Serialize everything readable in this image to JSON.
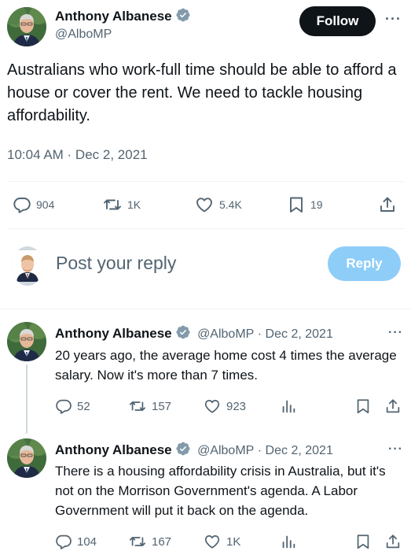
{
  "main_tweet": {
    "author_name": "Anthony Albanese",
    "author_handle": "@AlboMP",
    "follow_label": "Follow",
    "more_label": "···",
    "text": "Australians who work-full time should be able to afford a house or cover the rent. We need to tackle housing affordability.",
    "timestamp": "10:04 AM · Dec 2, 2021",
    "stats": {
      "replies": "904",
      "reposts": "1K",
      "likes": "5.4K",
      "bookmarks": "19"
    }
  },
  "reply_composer": {
    "placeholder": "Post your reply",
    "button_label": "Reply"
  },
  "replies": [
    {
      "author_name": "Anthony Albanese",
      "author_handle": "@AlboMP",
      "date": "· Dec 2, 2021",
      "more_label": "···",
      "text": "20 years ago, the average home cost 4 times the average salary. Now it's more than 7 times.",
      "stats": {
        "replies": "52",
        "reposts": "157",
        "likes": "923"
      }
    },
    {
      "author_name": "Anthony Albanese",
      "author_handle": "@AlboMP",
      "date": "· Dec 2, 2021",
      "more_label": "···",
      "text": "There is a housing affordability crisis in Australia, but it's not on the Morrison Government's agenda. A Labor Government will put it back on the agenda.",
      "stats": {
        "replies": "104",
        "reposts": "167",
        "likes": "1K"
      }
    }
  ],
  "colors": {
    "text_primary": "#0f1419",
    "text_secondary": "#536471",
    "verified_blue": "#1d9bf0",
    "reply_button_disabled": "#8ecdf8",
    "divider": "#eff3f4"
  },
  "icons": [
    "verified-badge-icon",
    "comment-icon",
    "repost-icon",
    "heart-icon",
    "bookmark-icon",
    "share-icon",
    "analytics-icon",
    "more-icon"
  ]
}
